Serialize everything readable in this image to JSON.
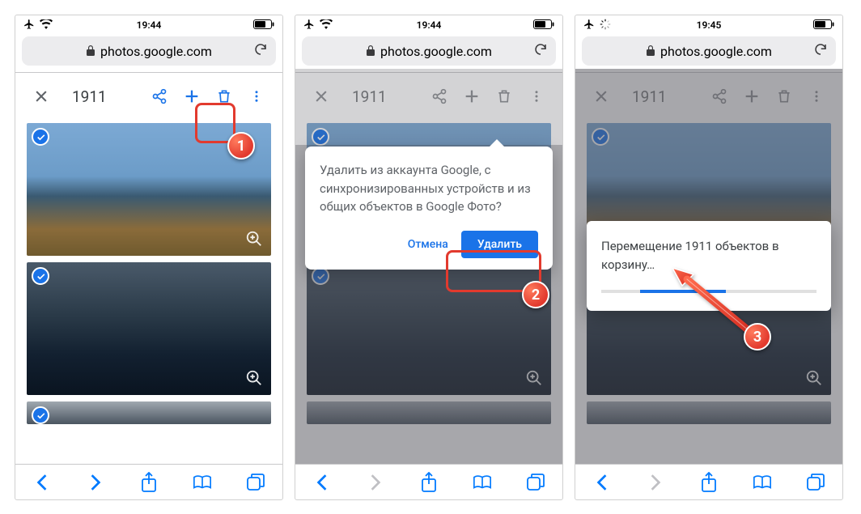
{
  "screens": {
    "s1": {
      "time": "19:44",
      "url": "photos.google.com",
      "selection_count": "1911"
    },
    "s2": {
      "time": "19:44",
      "url": "photos.google.com",
      "selection_count": "1911",
      "dialog_message": "Удалить из аккаунта Google, с синхронизированных устройств и из общих объектов в Google Фото?",
      "cancel_label": "Отмена",
      "delete_label": "Удалить"
    },
    "s3": {
      "time": "19:45",
      "url": "photos.google.com",
      "selection_count": "1911",
      "progress_message": "Перемещение 1911 объектов в корзину…"
    }
  },
  "steps": {
    "one": "1",
    "two": "2",
    "three": "3"
  }
}
